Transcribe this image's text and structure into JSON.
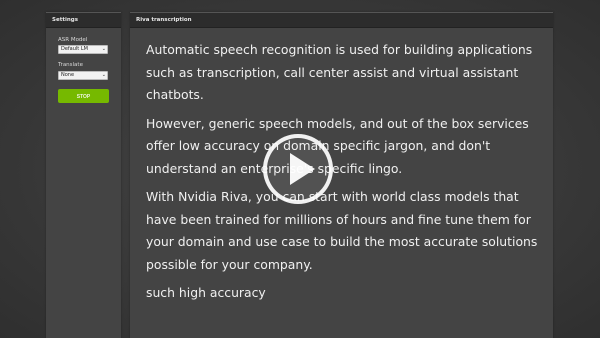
{
  "settings": {
    "header": "Settings",
    "asr_model_label": "ASR Model",
    "asr_model_value": "Default LM",
    "translate_label": "Translate",
    "translate_value": "None",
    "stop_label": "STOP"
  },
  "transcription": {
    "header": "Riva transcription",
    "paragraphs": [
      "Automatic speech recognition is used for building applications such as transcription, call center assist and virtual assistant chatbots.",
      "However, generic speech models, and out of the box services offer low accuracy on domain specific jargon, and don't understand an enterprise's specific lingo.",
      "With Nvidia Riva, you can start with world class models that have been trained for millions of hours and fine tune them for your domain and use case to build the most accurate solutions possible for your company.",
      "such high accuracy"
    ]
  },
  "colors": {
    "accent": "#76b900",
    "panel": "#444444",
    "header": "#2c2c2c"
  },
  "icons": {
    "overlay": "play-icon",
    "dropdown": "chevron-down-icon"
  }
}
